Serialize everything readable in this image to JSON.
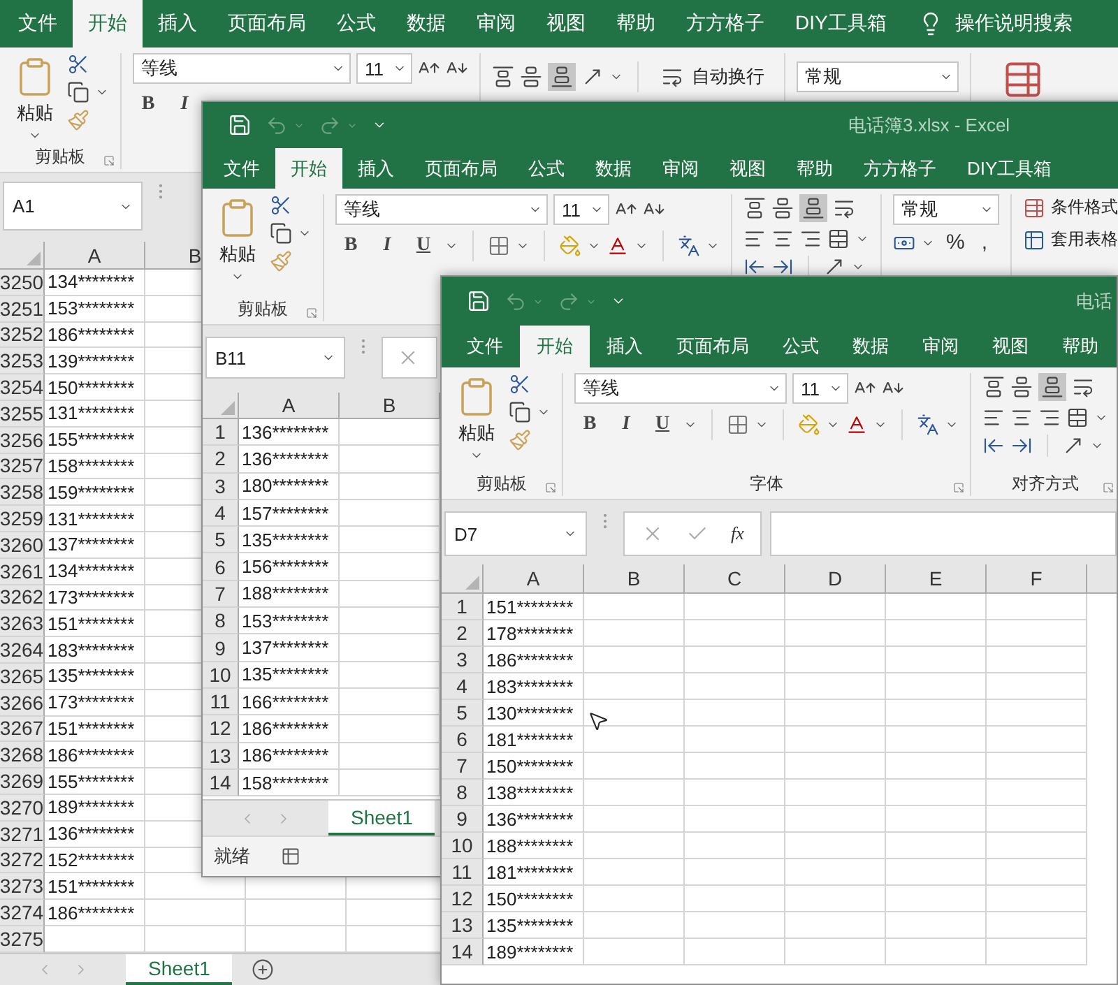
{
  "windows": [
    {
      "tabs": [
        {
          "label": "文件",
          "selected": false
        },
        {
          "label": "开始",
          "selected": true
        },
        {
          "label": "插入",
          "selected": false
        },
        {
          "label": "页面布局",
          "selected": false
        },
        {
          "label": "公式",
          "selected": false
        },
        {
          "label": "数据",
          "selected": false
        },
        {
          "label": "审阅",
          "selected": false
        },
        {
          "label": "视图",
          "selected": false
        },
        {
          "label": "帮助",
          "selected": false
        },
        {
          "label": "方方格子",
          "selected": false
        },
        {
          "label": "DIY工具箱",
          "selected": false
        }
      ],
      "search": "操作说明搜索",
      "ribbon": [
        {
          "kind": "clipboard",
          "paste": "粘贴",
          "label": "剪贴板"
        },
        {
          "kind": "font",
          "font": "等线",
          "size": "11",
          "bold": "B",
          "italic": "I"
        },
        {
          "kind": "align",
          "wrap": "自动换行"
        },
        {
          "kind": "number",
          "format": "常规"
        },
        {
          "kind": "styles"
        }
      ],
      "name_box": "A1",
      "columns": [
        "A",
        "B"
      ],
      "rows": [
        {
          "num": "3250",
          "value": "134********"
        },
        {
          "num": "3251",
          "value": "153********"
        },
        {
          "num": "3252",
          "value": "186********"
        },
        {
          "num": "3253",
          "value": "139********"
        },
        {
          "num": "3254",
          "value": "150********"
        },
        {
          "num": "3255",
          "value": "131********"
        },
        {
          "num": "3256",
          "value": "155********"
        },
        {
          "num": "3257",
          "value": "158********"
        },
        {
          "num": "3258",
          "value": "159********"
        },
        {
          "num": "3259",
          "value": "131********"
        },
        {
          "num": "3260",
          "value": "137********"
        },
        {
          "num": "3261",
          "value": "134********"
        },
        {
          "num": "3262",
          "value": "173********"
        },
        {
          "num": "3263",
          "value": "151********"
        },
        {
          "num": "3264",
          "value": "183********"
        },
        {
          "num": "3265",
          "value": "135********"
        },
        {
          "num": "3266",
          "value": "173********"
        },
        {
          "num": "3267",
          "value": "151********"
        },
        {
          "num": "3268",
          "value": "186********"
        },
        {
          "num": "3269",
          "value": "155********"
        },
        {
          "num": "3270",
          "value": "189********"
        },
        {
          "num": "3271",
          "value": "136********"
        },
        {
          "num": "3272",
          "value": "152********"
        },
        {
          "num": "3273",
          "value": "151********"
        },
        {
          "num": "3274",
          "value": "186********"
        },
        {
          "num": "3275"
        }
      ],
      "sheet_tabs": [
        {
          "label": "Sheet1",
          "selected": true
        }
      ]
    },
    {
      "title": "电话簿3.xlsx  -  Excel",
      "tabs": [
        {
          "label": "文件",
          "selected": false
        },
        {
          "label": "开始",
          "selected": true
        },
        {
          "label": "插入",
          "selected": false
        },
        {
          "label": "页面布局",
          "selected": false
        },
        {
          "label": "公式",
          "selected": false
        },
        {
          "label": "数据",
          "selected": false
        },
        {
          "label": "审阅",
          "selected": false
        },
        {
          "label": "视图",
          "selected": false
        },
        {
          "label": "帮助",
          "selected": false
        },
        {
          "label": "方方格子",
          "selected": false
        },
        {
          "label": "DIY工具箱",
          "selected": false
        }
      ],
      "ribbon": [
        {
          "kind": "clipboard",
          "paste": "粘贴",
          "label": "剪贴板"
        },
        {
          "kind": "font",
          "font": "等线",
          "size": "11",
          "bold": "B",
          "italic": "I",
          "underline": "U"
        },
        {
          "kind": "align"
        },
        {
          "kind": "number",
          "format": "常规",
          "percent": "%",
          "comma": ","
        },
        {
          "kind": "styles",
          "items": [
            "条件格式",
            "套用表格"
          ]
        }
      ],
      "name_box": "B11",
      "columns": [
        "A",
        "B"
      ],
      "rows": [
        {
          "num": "1",
          "value": "136********"
        },
        {
          "num": "2",
          "value": "136********"
        },
        {
          "num": "3",
          "value": "180********"
        },
        {
          "num": "4",
          "value": "157********"
        },
        {
          "num": "5",
          "value": "135********"
        },
        {
          "num": "6",
          "value": "156********"
        },
        {
          "num": "7",
          "value": "188********"
        },
        {
          "num": "8",
          "value": "153********"
        },
        {
          "num": "9",
          "value": "137********"
        },
        {
          "num": "10",
          "value": "135********"
        },
        {
          "num": "11",
          "value": "166********"
        },
        {
          "num": "12",
          "value": "186********"
        },
        {
          "num": "13",
          "value": "186********"
        },
        {
          "num": "14",
          "value": "158********"
        }
      ],
      "sheet_tabs": [
        {
          "label": "Sheet1",
          "selected": true
        }
      ],
      "status": "就绪"
    },
    {
      "title": "电话",
      "tabs": [
        {
          "label": "文件",
          "selected": false
        },
        {
          "label": "开始",
          "selected": true
        },
        {
          "label": "插入",
          "selected": false
        },
        {
          "label": "页面布局",
          "selected": false
        },
        {
          "label": "公式",
          "selected": false
        },
        {
          "label": "数据",
          "selected": false
        },
        {
          "label": "审阅",
          "selected": false
        },
        {
          "label": "视图",
          "selected": false
        },
        {
          "label": "帮助",
          "selected": false
        }
      ],
      "ribbon": [
        {
          "kind": "clipboard",
          "paste": "粘贴",
          "label": "剪贴板"
        },
        {
          "kind": "font",
          "font": "等线",
          "size": "11",
          "bold": "B",
          "italic": "I",
          "underline": "U",
          "label": "字体"
        },
        {
          "kind": "align",
          "label": "对齐方式"
        }
      ],
      "name_box": "D7",
      "function_label": "fx",
      "columns": [
        "A",
        "B",
        "C",
        "D",
        "E",
        "F"
      ],
      "rows": [
        {
          "num": "1",
          "value": "151********"
        },
        {
          "num": "2",
          "value": "178********"
        },
        {
          "num": "3",
          "value": "186********"
        },
        {
          "num": "4",
          "value": "183********"
        },
        {
          "num": "5",
          "value": "130********"
        },
        {
          "num": "6",
          "value": "181********"
        },
        {
          "num": "7",
          "value": "150********"
        },
        {
          "num": "8",
          "value": "138********"
        },
        {
          "num": "9",
          "value": "136********"
        },
        {
          "num": "10",
          "value": "188********"
        },
        {
          "num": "11",
          "value": "181********"
        },
        {
          "num": "12",
          "value": "150********"
        },
        {
          "num": "13",
          "value": "135********"
        },
        {
          "num": "14",
          "value": "189********"
        }
      ]
    }
  ]
}
